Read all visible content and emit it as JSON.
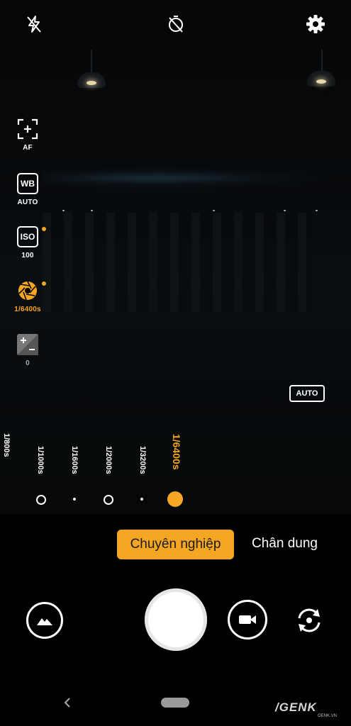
{
  "top_bar": {
    "flash_icon": "flash-off-icon",
    "timer_icon": "timer-off-icon",
    "settings_icon": "gear-icon"
  },
  "side_controls": [
    {
      "icon": "focus-icon",
      "label": "AF",
      "active": false
    },
    {
      "icon": "white-balance-icon",
      "label": "AUTO",
      "active": false
    },
    {
      "icon": "iso-icon",
      "label": "100",
      "active": false,
      "modified": true
    },
    {
      "icon": "shutter-speed-icon",
      "label": "1/6400s",
      "active": true,
      "modified": true
    },
    {
      "icon": "exposure-compensation-icon",
      "label": "0",
      "active": false,
      "disabled": true
    }
  ],
  "wb_text": "WB",
  "iso_text": "ISO",
  "auto_button": "AUTO",
  "shutter_scale": {
    "labels": [
      "1/800s",
      "1/1000s",
      "1/1600s",
      "1/2000s",
      "1/3200s",
      "1/6400s"
    ],
    "selected": "1/6400s"
  },
  "modes": {
    "pro": "Chuyên nghiệp",
    "portrait": "Chân dung"
  },
  "bottom_controls": {
    "gallery_icon": "gallery-icon",
    "video_icon": "video-camera-icon",
    "switch_icon": "switch-camera-icon"
  },
  "watermark": {
    "brand": "/GENK",
    "site": "GENK.VN"
  },
  "colors": {
    "accent": "#f5a623",
    "background": "#000000"
  }
}
